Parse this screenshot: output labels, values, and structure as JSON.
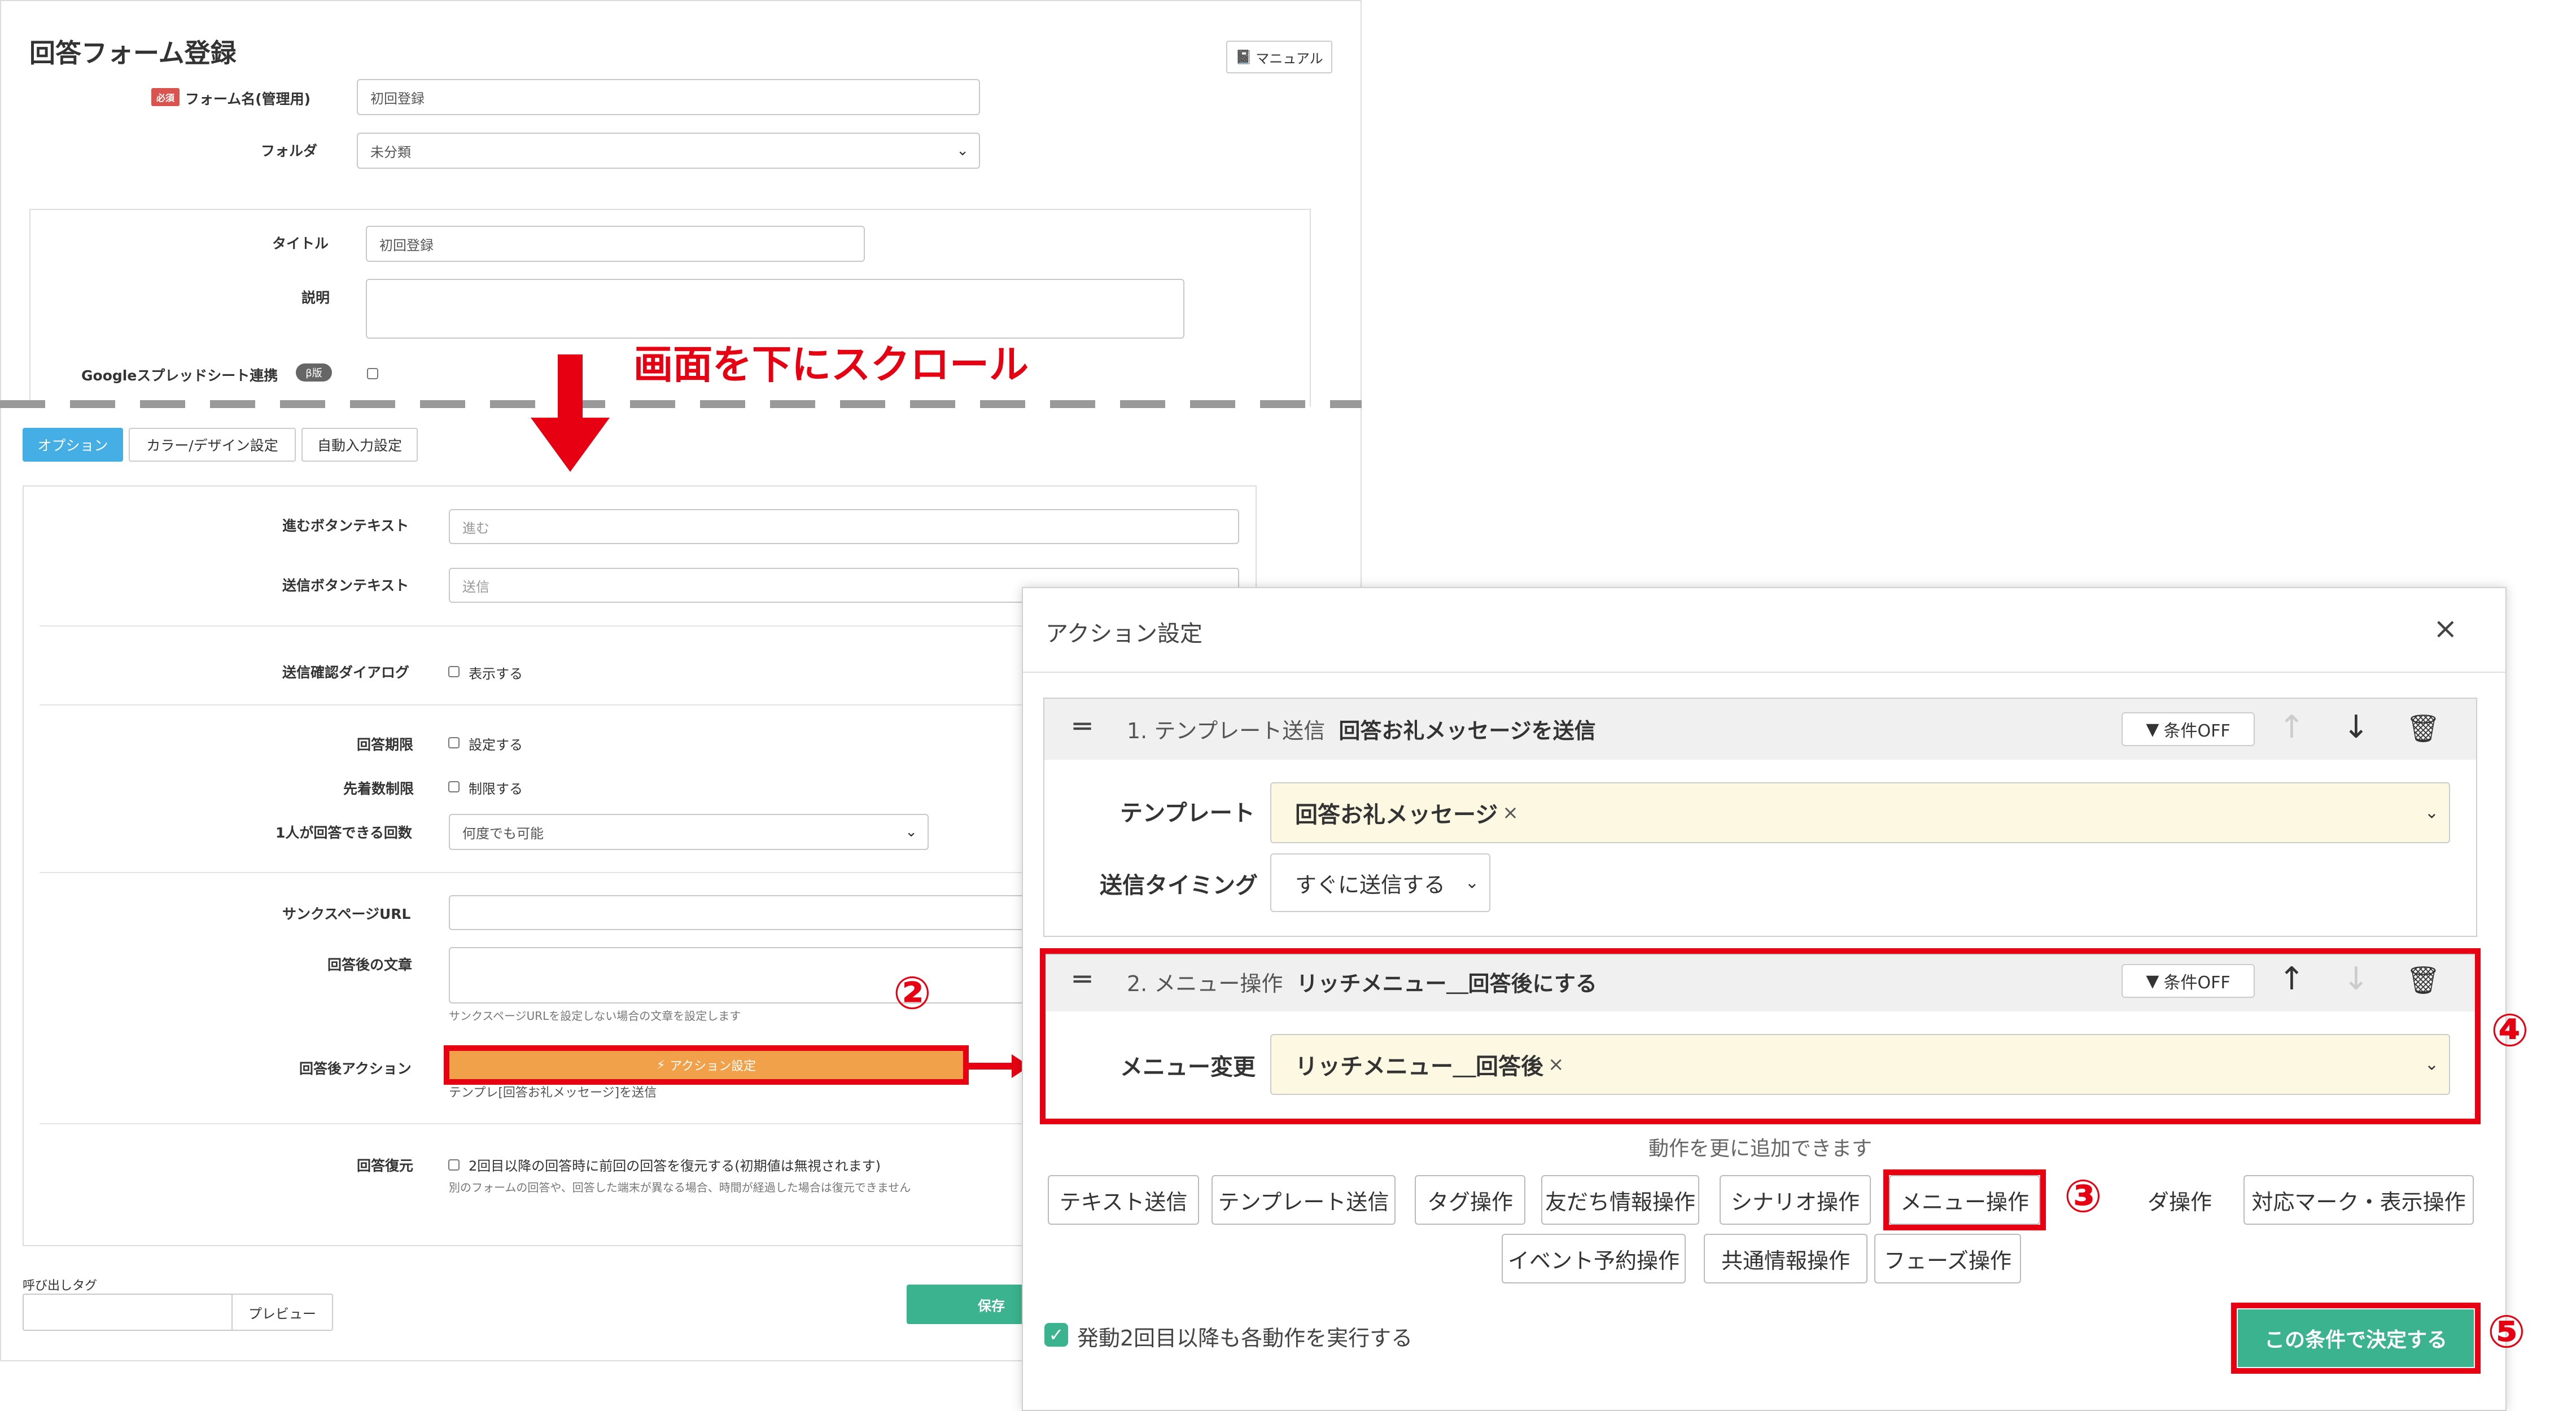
{
  "form": {
    "page_title": "回答フォーム登録",
    "manual_button": "マニュアル",
    "required_badge": "必須",
    "form_name_label": "フォーム名(管理用)",
    "form_name_value": "初回登録",
    "folder_label": "フォルダ",
    "folder_value": "未分類",
    "title_label": "タイトル",
    "title_value": "初回登録",
    "description_label": "説明",
    "google_sheets_label": "Googleスプレッドシート連携",
    "google_sheets_badge": "β版"
  },
  "annotations": {
    "scroll_note": "画面を下にスクロール",
    "num2": "②",
    "num3": "③",
    "num4": "④",
    "num5": "⑤"
  },
  "tabs": [
    "オプション",
    "カラー/デザイン設定",
    "自動入力設定"
  ],
  "options": {
    "next_button_label": "進むボタンテキスト",
    "next_button_placeholder": "進む",
    "submit_button_label": "送信ボタンテキスト",
    "submit_button_placeholder": "送信",
    "confirm_dialog_label": "送信確認ダイアログ",
    "confirm_dialog_check": "表示する",
    "deadline_label": "回答期限",
    "deadline_check": "設定する",
    "first_come_label": "先着数制限",
    "first_come_check": "制限する",
    "per_person_label": "1人が回答できる回数",
    "per_person_value": "何度でも可能",
    "thanks_url_label": "サンクスページURL",
    "after_text_label": "回答後の文章",
    "after_text_hint": "サンクスページURLを設定しない場合の文章を設定します",
    "after_action_label": "回答後アクション",
    "action_button": "アクション設定",
    "action_note": "テンプレ[回答お礼メッセージ]を送信",
    "restore_label": "回答復元",
    "restore_check": "2回目以降の回答時に前回の回答を復元する(初期値は無視されます)",
    "restore_hint": "別のフォームの回答や、回答した端末が異なる場合、時間が経過した場合は復元できません",
    "call_tag_label": "呼び出しタグ",
    "preview_button": "プレビュー",
    "save_button": "保存"
  },
  "modal": {
    "title": "アクション設定",
    "close": "×",
    "item1": {
      "header_prefix": "1. テンプレート送信",
      "header_name": "回答お礼メッセージを送信",
      "condition_button": "条件OFF",
      "template_label": "テンプレート",
      "template_value": "回答お礼メッセージ",
      "timing_label": "送信タイミング",
      "timing_value": "すぐに送信する"
    },
    "item2": {
      "header_prefix": "2. メニュー操作",
      "header_name": "リッチメニュー＿回答後にする",
      "condition_button": "条件OFF",
      "menu_change_label": "メニュー変更",
      "menu_change_value": "リッチメニュー＿回答後"
    },
    "add_more_text": "動作を更に追加できます",
    "action_buttons_row1": [
      "テキスト送信",
      "テンプレート送信",
      "タグ操作",
      "友だち情報操作",
      "シナリオ操作",
      "メニュー操作",
      "ダ操作",
      "対応マーク・表示操作"
    ],
    "action_buttons_row2": [
      "イベント予約操作",
      "共通情報操作",
      "フェーズ操作"
    ],
    "repeat_check": "発動2回目以降も各動作を実行する",
    "confirm_button": "この条件で決定する"
  },
  "colors": {
    "accent_blue": "#45aee4",
    "action_orange": "#f0a14a",
    "save_green": "#3bb38e",
    "annotation_red": "#e60012",
    "field_yellow": "#fdf8e1"
  }
}
